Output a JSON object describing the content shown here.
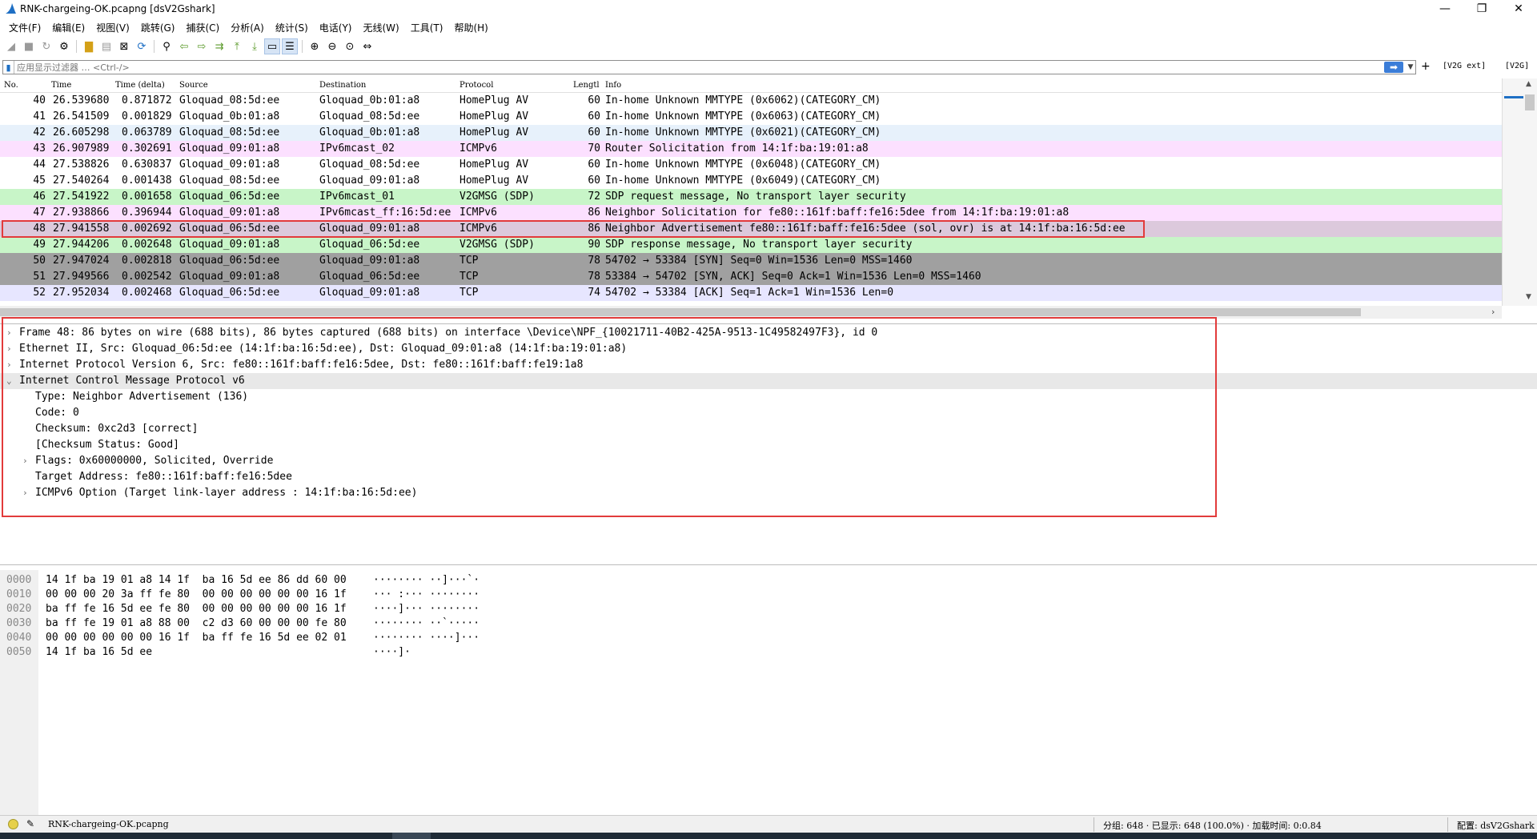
{
  "window": {
    "title": "RNK-chargeing-OK.pcapng [dsV2Gshark]",
    "min_glyph": "—",
    "max_glyph": "❐",
    "close_glyph": "✕"
  },
  "menu": [
    "文件(F)",
    "编辑(E)",
    "视图(V)",
    "跳转(G)",
    "捕获(C)",
    "分析(A)",
    "统计(S)",
    "电话(Y)",
    "无线(W)",
    "工具(T)",
    "帮助(H)"
  ],
  "filter": {
    "placeholder": "应用显示过滤器 … <Ctrl-/>",
    "plus": "+",
    "btn_ext": "[V2G ext]",
    "btn_v2g": "[V2G]"
  },
  "packet_list": {
    "columns": [
      "No.",
      "Time",
      "Time (delta)",
      "Source",
      "Destination",
      "Protocol",
      "Lengtl",
      "Info"
    ],
    "rows": [
      {
        "no": "40",
        "time": "26.539680",
        "delta": "0.871872",
        "src": "Gloquad_08:5d:ee",
        "dst": "Gloquad_0b:01:a8",
        "proto": "HomePlug AV",
        "len": "60",
        "info": "In-home Unknown MMTYPE (0x6062)(CATEGORY_CM)",
        "bg": "#ffffff"
      },
      {
        "no": "41",
        "time": "26.541509",
        "delta": "0.001829",
        "src": "Gloquad_0b:01:a8",
        "dst": "Gloquad_08:5d:ee",
        "proto": "HomePlug AV",
        "len": "60",
        "info": "In-home Unknown MMTYPE (0x6063)(CATEGORY_CM)",
        "bg": "#ffffff"
      },
      {
        "no": "42",
        "time": "26.605298",
        "delta": "0.063789",
        "src": "Gloquad_08:5d:ee",
        "dst": "Gloquad_0b:01:a8",
        "proto": "HomePlug AV",
        "len": "60",
        "info": "In-home Unknown MMTYPE (0x6021)(CATEGORY_CM)",
        "bg": "#e7f1fb"
      },
      {
        "no": "43",
        "time": "26.907989",
        "delta": "0.302691",
        "src": "Gloquad_09:01:a8",
        "dst": "IPv6mcast_02",
        "proto": "ICMPv6",
        "len": "70",
        "info": "Router Solicitation from 14:1f:ba:19:01:a8",
        "bg": "#fce0ff"
      },
      {
        "no": "44",
        "time": "27.538826",
        "delta": "0.630837",
        "src": "Gloquad_09:01:a8",
        "dst": "Gloquad_08:5d:ee",
        "proto": "HomePlug AV",
        "len": "60",
        "info": "In-home Unknown MMTYPE (0x6048)(CATEGORY_CM)",
        "bg": "#ffffff"
      },
      {
        "no": "45",
        "time": "27.540264",
        "delta": "0.001438",
        "src": "Gloquad_08:5d:ee",
        "dst": "Gloquad_09:01:a8",
        "proto": "HomePlug AV",
        "len": "60",
        "info": "In-home Unknown MMTYPE (0x6049)(CATEGORY_CM)",
        "bg": "#ffffff"
      },
      {
        "no": "46",
        "time": "27.541922",
        "delta": "0.001658",
        "src": "Gloquad_06:5d:ee",
        "dst": "IPv6mcast_01",
        "proto": "V2GMSG (SDP)",
        "len": "72",
        "info": "SDP request message, No transport layer security",
        "bg": "#c8f5c8"
      },
      {
        "no": "47",
        "time": "27.938866",
        "delta": "0.396944",
        "src": "Gloquad_09:01:a8",
        "dst": "IPv6mcast_ff:16:5d:ee",
        "proto": "ICMPv6",
        "len": "86",
        "info": "Neighbor Solicitation for fe80::161f:baff:fe16:5dee from 14:1f:ba:19:01:a8",
        "bg": "#fce0ff"
      },
      {
        "no": "48",
        "time": "27.941558",
        "delta": "0.002692",
        "src": "Gloquad_06:5d:ee",
        "dst": "Gloquad_09:01:a8",
        "proto": "ICMPv6",
        "len": "86",
        "info": "Neighbor Advertisement fe80::161f:baff:fe16:5dee (sol, ovr) is at 14:1f:ba:16:5d:ee",
        "bg": "#dcc9dc"
      },
      {
        "no": "49",
        "time": "27.944206",
        "delta": "0.002648",
        "src": "Gloquad_09:01:a8",
        "dst": "Gloquad_06:5d:ee",
        "proto": "V2GMSG (SDP)",
        "len": "90",
        "info": "SDP response message, No transport layer security",
        "bg": "#c8f5c8"
      },
      {
        "no": "50",
        "time": "27.947024",
        "delta": "0.002818",
        "src": "Gloquad_06:5d:ee",
        "dst": "Gloquad_09:01:a8",
        "proto": "TCP",
        "len": "78",
        "info": "54702 → 53384 [SYN] Seq=0 Win=1536 Len=0 MSS=1460",
        "bg": "#a0a0a0"
      },
      {
        "no": "51",
        "time": "27.949566",
        "delta": "0.002542",
        "src": "Gloquad_09:01:a8",
        "dst": "Gloquad_06:5d:ee",
        "proto": "TCP",
        "len": "78",
        "info": "53384 → 54702 [SYN, ACK] Seq=0 Ack=1 Win=1536 Len=0 MSS=1460",
        "bg": "#a0a0a0"
      },
      {
        "no": "52",
        "time": "27.952034",
        "delta": "0.002468",
        "src": "Gloquad_06:5d:ee",
        "dst": "Gloquad_09:01:a8",
        "proto": "TCP",
        "len": "74",
        "info": "54702 → 53384 [ACK] Seq=1 Ack=1 Win=1536 Len=0",
        "bg": "#e7e6ff"
      }
    ]
  },
  "details": [
    {
      "text": "Frame 48: 86 bytes on wire (688 bits), 86 bytes captured (688 bits) on interface \\Device\\NPF_{10021711-40B2-425A-9513-1C49582497F3}, id 0",
      "tw": "›"
    },
    {
      "text": "Ethernet II, Src: Gloquad_06:5d:ee (14:1f:ba:16:5d:ee), Dst: Gloquad_09:01:a8 (14:1f:ba:19:01:a8)",
      "tw": "›"
    },
    {
      "text": "Internet Protocol Version 6, Src: fe80::161f:baff:fe16:5dee, Dst: fe80::161f:baff:fe19:1a8",
      "tw": "›"
    },
    {
      "text": "Internet Control Message Protocol v6",
      "tw": "⌄"
    },
    {
      "text": "Type: Neighbor Advertisement (136)",
      "tw": ""
    },
    {
      "text": "Code: 0",
      "tw": ""
    },
    {
      "text": "Checksum: 0xc2d3 [correct]",
      "tw": ""
    },
    {
      "text": "[Checksum Status: Good]",
      "tw": ""
    },
    {
      "text": "Flags: 0x60000000, Solicited, Override",
      "tw": "›"
    },
    {
      "text": "Target Address: fe80::161f:baff:fe16:5dee",
      "tw": ""
    },
    {
      "text": "ICMPv6 Option (Target link-layer address : 14:1f:ba:16:5d:ee)",
      "tw": "›"
    }
  ],
  "hex": [
    {
      "off": "0000",
      "bytes": "14 1f ba 19 01 a8 14 1f  ba 16 5d ee 86 dd 60 00",
      "ascii": "········ ··]···`·"
    },
    {
      "off": "0010",
      "bytes": "00 00 00 20 3a ff fe 80  00 00 00 00 00 00 16 1f",
      "ascii": "··· :··· ········"
    },
    {
      "off": "0020",
      "bytes": "ba ff fe 16 5d ee fe 80  00 00 00 00 00 00 16 1f",
      "ascii": "····]··· ········"
    },
    {
      "off": "0030",
      "bytes": "ba ff fe 19 01 a8 88 00  c2 d3 60 00 00 00 fe 80",
      "ascii": "········ ··`·····"
    },
    {
      "off": "0040",
      "bytes": "00 00 00 00 00 00 16 1f  ba ff fe 16 5d ee 02 01",
      "ascii": "········ ····]···"
    },
    {
      "off": "0050",
      "bytes": "14 1f ba 16 5d ee",
      "ascii": "····]·"
    }
  ],
  "status": {
    "file": "RNK-chargeing-OK.pcapng",
    "stats": "分组: 648 · 已显示: 648 (100.0%)  ·  加载时间: 0:0.84",
    "profile": "配置: dsV2Gshark"
  }
}
